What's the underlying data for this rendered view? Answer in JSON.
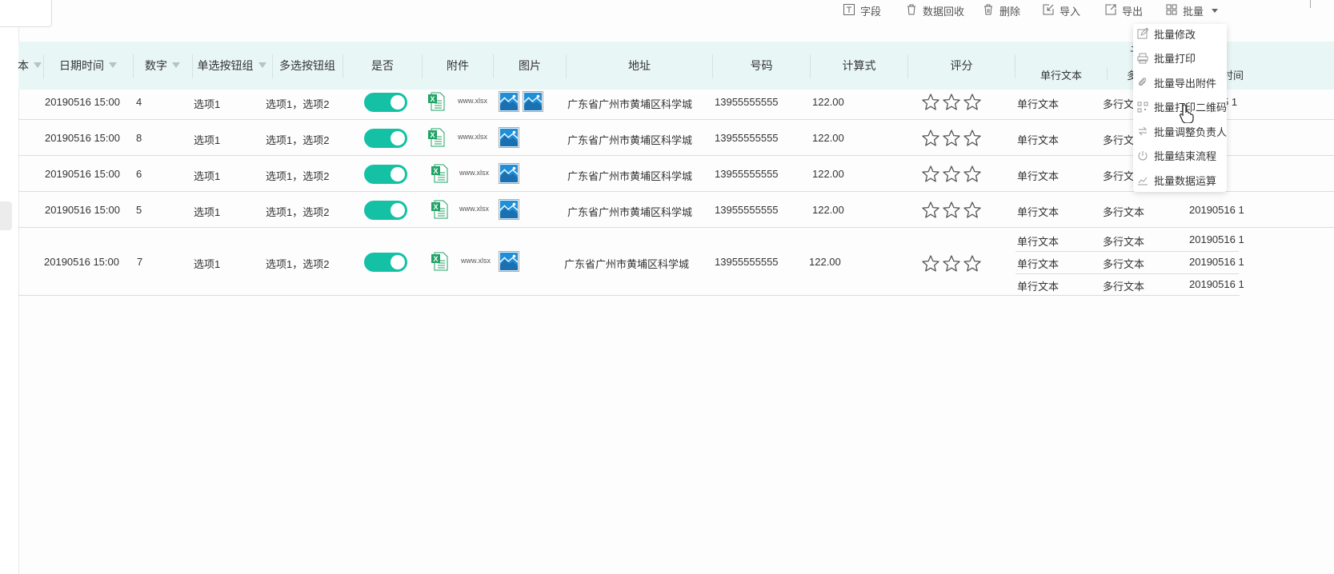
{
  "toolbar": {
    "fields": "字段",
    "recycle": "数据回收",
    "delete": "删除",
    "import": "导入",
    "export": "导出",
    "batch": "批量"
  },
  "table": {
    "headers": {
      "text_partial": "本",
      "datetime": "日期时间",
      "number": "数字",
      "radio": "单选按钮组",
      "checkbox": "多选按钮组",
      "yesno": "是否",
      "attachment": "附件",
      "image": "图片",
      "address": "地址",
      "phone": "号码",
      "formula": "计算式",
      "rating": "评分",
      "sub_top": "子",
      "sub_single": "单行文本",
      "sub_multi": "多",
      "sub_time": "时间"
    },
    "rows": [
      {
        "datetime": "20190516 15:00",
        "number": "4",
        "radio": "选项1",
        "checkbox": "选项1，选项2",
        "file": "www.xlsx",
        "address": "广东省广州市黄埔区科学城",
        "phone": "13955555555",
        "formula": "122.00",
        "sub": [
          {
            "single": "单行文本",
            "multi": "多行文",
            "time": "5 1"
          }
        ]
      },
      {
        "datetime": "20190516 15:00",
        "number": "8",
        "radio": "选项1",
        "checkbox": "选项1，选项2",
        "file": "www.xlsx",
        "address": "广东省广州市黄埔区科学城",
        "phone": "13955555555",
        "formula": "122.00",
        "sub": [
          {
            "single": "单行文本",
            "multi": "多行文",
            "time": ""
          }
        ]
      },
      {
        "datetime": "20190516 15:00",
        "number": "6",
        "radio": "选项1",
        "checkbox": "选项1，选项2",
        "file": "www.xlsx",
        "address": "广东省广州市黄埔区科学城",
        "phone": "13955555555",
        "formula": "122.00",
        "sub": [
          {
            "single": "单行文本",
            "multi": "多行文",
            "time": ""
          }
        ]
      },
      {
        "datetime": "20190516 15:00",
        "number": "5",
        "radio": "选项1",
        "checkbox": "选项1，选项2",
        "file": "www.xlsx",
        "address": "广东省广州市黄埔区科学城",
        "phone": "13955555555",
        "formula": "122.00",
        "sub": [
          {
            "single": "单行文本",
            "multi": "多行文本",
            "time": "20190516 1"
          }
        ]
      },
      {
        "datetime": "20190516 15:00",
        "number": "7",
        "radio": "选项1",
        "checkbox": "选项1，选项2",
        "file": "www.xlsx",
        "address": "广东省广州市黄埔区科学城",
        "phone": "13955555555",
        "formula": "122.00",
        "sub": [
          {
            "single": "单行文本",
            "multi": "多行文本",
            "time": "20190516 1"
          },
          {
            "single": "单行文本",
            "multi": "多行文本",
            "time": "20190516 1"
          },
          {
            "single": "单行文本",
            "multi": "多行文本",
            "time": "20190516 1"
          }
        ]
      }
    ]
  },
  "dropdown": {
    "items": [
      {
        "label": "批量修改",
        "icon": "edit-icon"
      },
      {
        "label": "批量打印",
        "icon": "printer-icon"
      },
      {
        "label": "批量导出附件",
        "icon": "paperclip-icon"
      },
      {
        "label": "批量打印二维码",
        "icon": "qrcode-icon"
      },
      {
        "label": "批量调整负责人",
        "icon": "swap-icon"
      },
      {
        "label": "批量结束流程",
        "icon": "power-icon"
      },
      {
        "label": "批量数据运算",
        "icon": "chart-icon"
      }
    ]
  },
  "colors": {
    "accent": "#14c1a4",
    "header_bg": "#e9f6f6",
    "excel_green": "#21a366",
    "image_blue": "#1e8fd8"
  }
}
